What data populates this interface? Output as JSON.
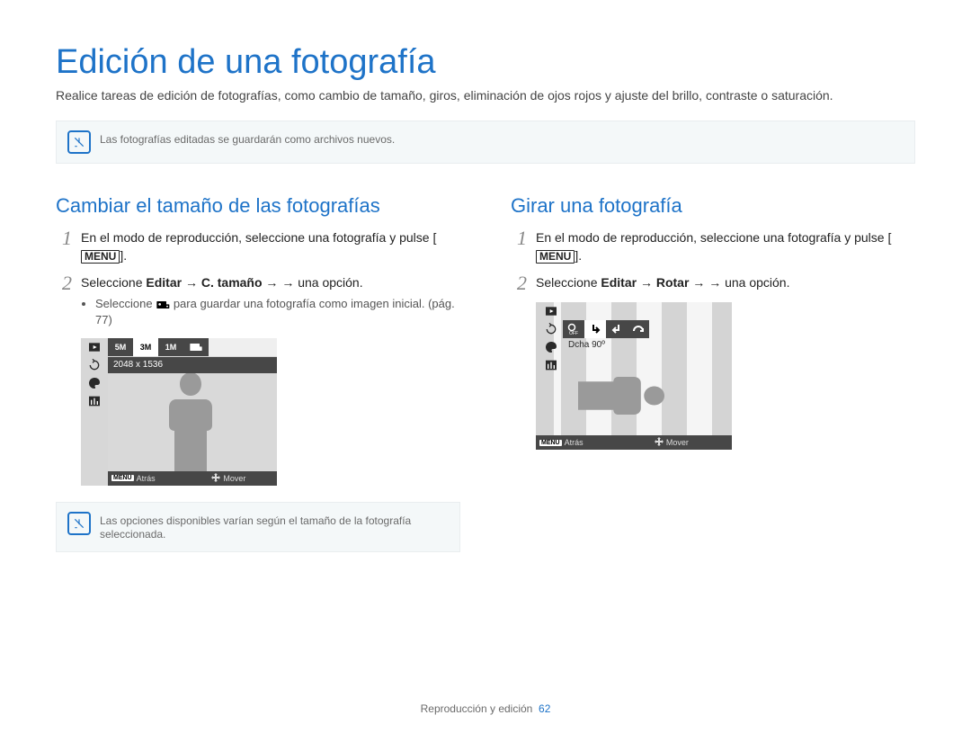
{
  "title": "Edición de una fotografía",
  "intro": "Realice tareas de edición de fotografías, como cambio de tamaño, giros, eliminación de ojos rojos y ajuste del brillo, contraste o saturación.",
  "note_top": "Las fotografías editadas se guardarán como archivos nuevos.",
  "menu_label": "MENU",
  "left": {
    "heading": "Cambiar el tamaño de las fotografías",
    "step1_a": "En el modo de reproducción, seleccione una fotografía y pulse [",
    "step1_b": "].",
    "step2_pre": "Seleccione ",
    "step2_b1": "Editar",
    "step2_arrow": " → ",
    "step2_b2": "C. tamaño",
    "step2_post": " → una opción.",
    "bullet_a": "Seleccione ",
    "bullet_b": " para guardar una fotografía como imagen inicial. (pág. 77)",
    "screen": {
      "tabs": [
        "5M",
        "3M",
        "1M"
      ],
      "label": "2048 x 1536",
      "back": "Atrás",
      "move": "Mover"
    },
    "note_bottom": "Las opciones disponibles varían según el tamaño de la fotografía seleccionada."
  },
  "right": {
    "heading": "Girar una fotografía",
    "step1_a": "En el modo de reproducción, seleccione una fotografía y pulse [",
    "step1_b": "].",
    "step2_pre": "Seleccione ",
    "step2_b1": "Editar",
    "step2_arrow": " → ",
    "step2_b2": "Rotar",
    "step2_post": " → una opción.",
    "screen": {
      "label": "Dcha 90º",
      "back": "Atrás",
      "move": "Mover"
    }
  },
  "footer": {
    "section": "Reproducción y edición",
    "page": "62"
  }
}
